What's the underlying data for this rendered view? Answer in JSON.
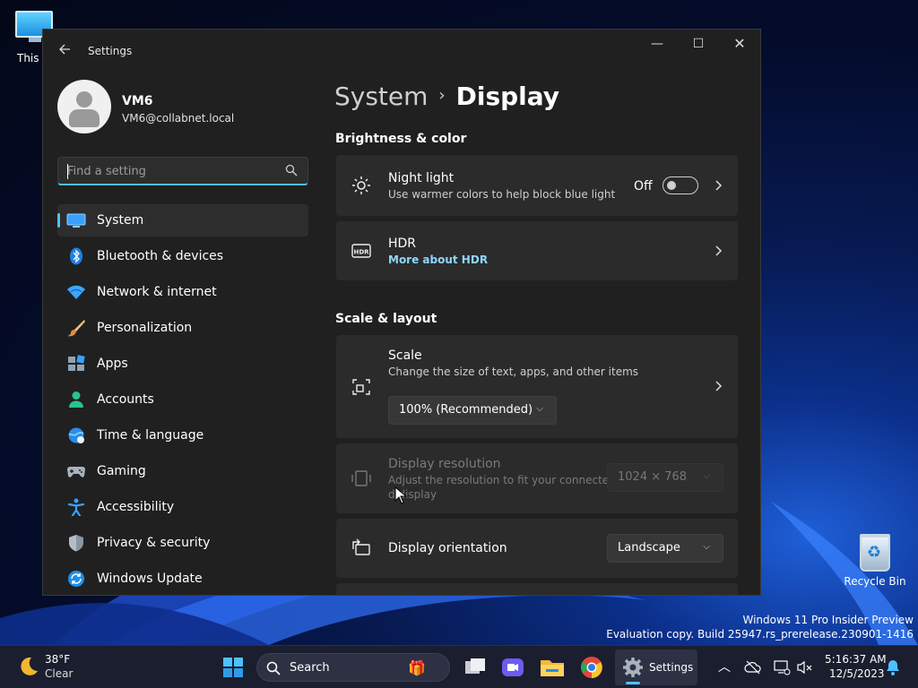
{
  "desktop": {
    "this_pc_label": "This P",
    "recycle_bin_label": "Recycle Bin",
    "watermark_line1": "Windows 11 Pro Insider Preview",
    "watermark_line2": "Evaluation copy. Build 25947.rs_prerelease.230901-1416"
  },
  "window": {
    "title": "Settings",
    "controls": {
      "minimize": "—",
      "maximize": "☐",
      "close": "✕"
    }
  },
  "profile": {
    "name": "VM6",
    "email": "VM6@collabnet.local"
  },
  "search": {
    "placeholder": "Find a setting"
  },
  "nav": {
    "items": [
      {
        "label": "System",
        "icon": "system-icon",
        "active": true
      },
      {
        "label": "Bluetooth & devices",
        "icon": "bluetooth-icon"
      },
      {
        "label": "Network & internet",
        "icon": "wifi-icon"
      },
      {
        "label": "Personalization",
        "icon": "brush-icon"
      },
      {
        "label": "Apps",
        "icon": "apps-icon"
      },
      {
        "label": "Accounts",
        "icon": "accounts-icon"
      },
      {
        "label": "Time & language",
        "icon": "globe-clock-icon"
      },
      {
        "label": "Gaming",
        "icon": "gamepad-icon"
      },
      {
        "label": "Accessibility",
        "icon": "accessibility-icon"
      },
      {
        "label": "Privacy & security",
        "icon": "shield-icon"
      },
      {
        "label": "Windows Update",
        "icon": "update-icon"
      }
    ]
  },
  "main": {
    "breadcrumb": {
      "parent": "System",
      "separator": "›",
      "current": "Display"
    },
    "brightness": {
      "heading": "Brightness & color",
      "night_light": {
        "title": "Night light",
        "desc": "Use warmer colors to help block blue light",
        "state": "Off"
      },
      "hdr": {
        "title": "HDR",
        "link": "More about HDR"
      }
    },
    "scale_layout": {
      "heading": "Scale & layout",
      "scale": {
        "title": "Scale",
        "desc": "Change the size of text, apps, and other items",
        "value": "100% (Recommended)"
      },
      "resolution": {
        "title": "Display resolution",
        "desc_line1": "Adjust the resolution to fit your connecte",
        "desc_line2": "d display",
        "value": "1024 × 768"
      },
      "orientation": {
        "title": "Display orientation",
        "value": "Landscape"
      }
    }
  },
  "taskbar": {
    "weather": {
      "temp": "38°F",
      "desc": "Clear"
    },
    "search_label": "Search",
    "settings_label": "Settings",
    "clock": {
      "time": "5:16:37 AM",
      "date": "12/5/2023"
    }
  },
  "colors": {
    "accent": "#4cc2ff",
    "window_bg": "#202020",
    "card_bg": "#2b2b2b"
  }
}
